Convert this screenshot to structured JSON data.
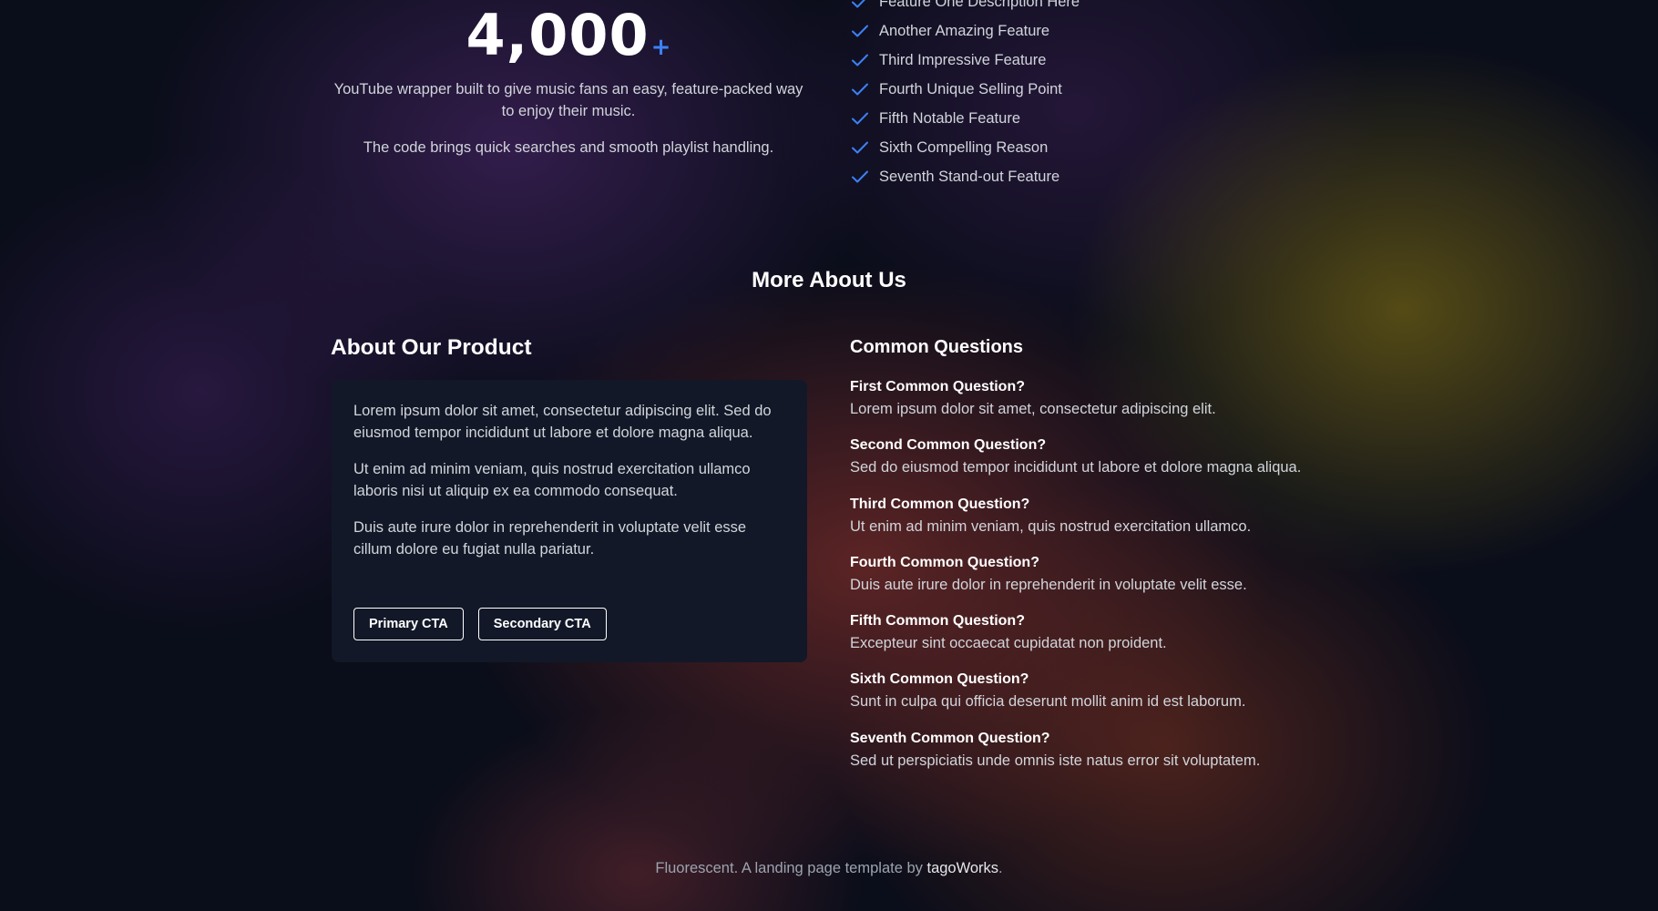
{
  "stat": {
    "number": "4,000",
    "suffix": "+",
    "description": "YouTube wrapper built to give music fans an easy, feature-packed way to enjoy their music.",
    "description_2": "The code brings quick searches and smooth playlist handling."
  },
  "features": {
    "icon": "check-icon",
    "check_color": "#3b82f6",
    "items": [
      "Feature One Description Here",
      "Another Amazing Feature",
      "Third Impressive Feature",
      "Fourth Unique Selling Point",
      "Fifth Notable Feature",
      "Sixth Compelling Reason",
      "Seventh Stand-out Feature"
    ]
  },
  "section": {
    "title": "More About Us"
  },
  "about": {
    "heading": "About Our Product",
    "paragraphs": [
      "Lorem ipsum dolor sit amet, consectetur adipiscing elit. Sed do eiusmod tempor incididunt ut labore et dolore magna aliqua.",
      "Ut enim ad minim veniam, quis nostrud exercitation ullamco laboris nisi ut aliquip ex ea commodo consequat.",
      "Duis aute irure dolor in reprehenderit in voluptate velit esse cillum dolore eu fugiat nulla pariatur."
    ],
    "primary_cta": "Primary CTA",
    "secondary_cta": "Secondary CTA"
  },
  "faq": {
    "heading": "Common Questions",
    "items": [
      {
        "q": "First Common Question?",
        "a": "Lorem ipsum dolor sit amet, consectetur adipiscing elit."
      },
      {
        "q": "Second Common Question?",
        "a": "Sed do eiusmod tempor incididunt ut labore et dolore magna aliqua."
      },
      {
        "q": "Third Common Question?",
        "a": "Ut enim ad minim veniam, quis nostrud exercitation ullamco."
      },
      {
        "q": "Fourth Common Question?",
        "a": "Duis aute irure dolor in reprehenderit in voluptate velit esse."
      },
      {
        "q": "Fifth Common Question?",
        "a": "Excepteur sint occaecat cupidatat non proident."
      },
      {
        "q": "Sixth Common Question?",
        "a": "Sunt in culpa qui officia deserunt mollit anim id est laborum."
      },
      {
        "q": "Seventh Common Question?",
        "a": "Sed ut perspiciatis unde omnis iste natus error sit voluptatem."
      }
    ]
  },
  "footer": {
    "text_before": "Fluorescent. A landing page template by ",
    "link": "tagoWorks",
    "text_after": "."
  }
}
